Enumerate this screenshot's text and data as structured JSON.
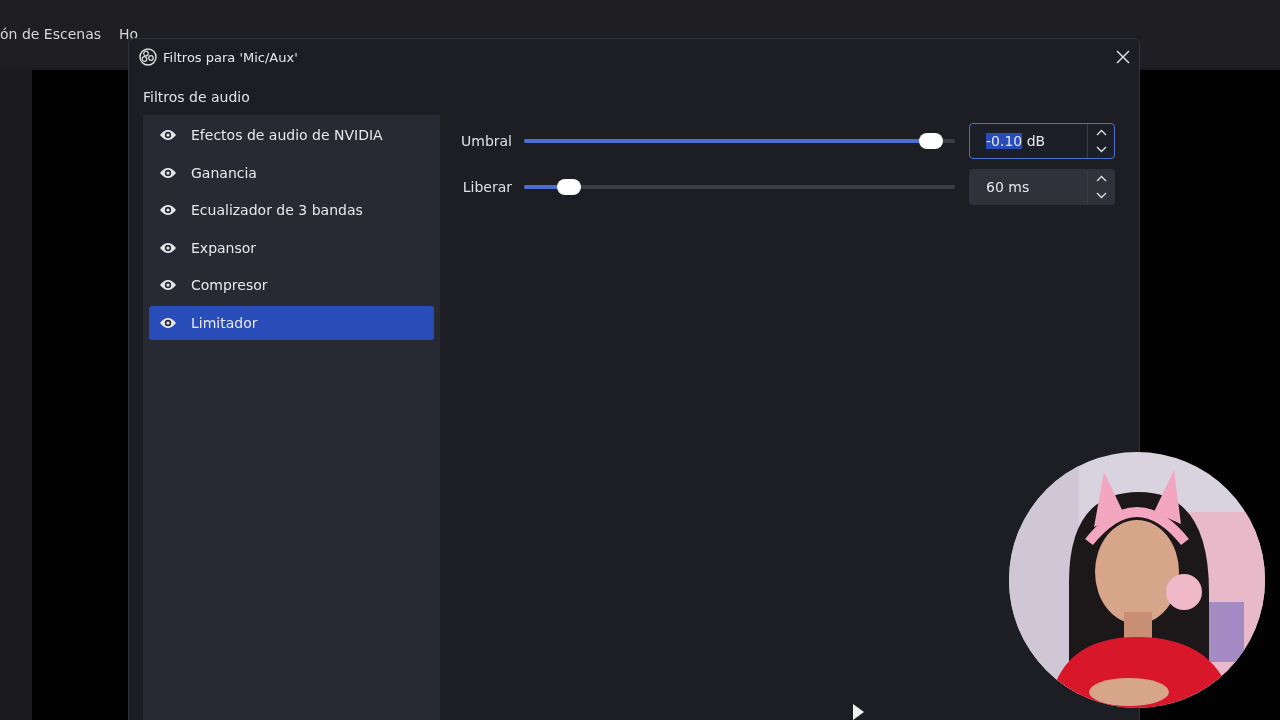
{
  "background": {
    "menu_items": [
      "ón de Escenas",
      "Ho"
    ]
  },
  "dialog": {
    "title": "Filtros para 'Mic/Aux'",
    "section_label": "Filtros de audio",
    "filters": [
      {
        "name": "Efectos de audio de NVIDIA",
        "visible": true,
        "selected": false
      },
      {
        "name": "Ganancia",
        "visible": true,
        "selected": false
      },
      {
        "name": "Ecualizador de 3 bandas",
        "visible": true,
        "selected": false
      },
      {
        "name": "Expansor",
        "visible": true,
        "selected": false
      },
      {
        "name": "Compresor",
        "visible": true,
        "selected": false
      },
      {
        "name": "Limitador",
        "visible": true,
        "selected": true
      }
    ],
    "properties": [
      {
        "label": "Umbral",
        "level": 0.97,
        "value": "-0.10",
        "unit": "dB",
        "focused": true
      },
      {
        "label": "Liberar",
        "level": 0.08,
        "value": "60",
        "unit": "ms",
        "focused": false
      }
    ]
  }
}
